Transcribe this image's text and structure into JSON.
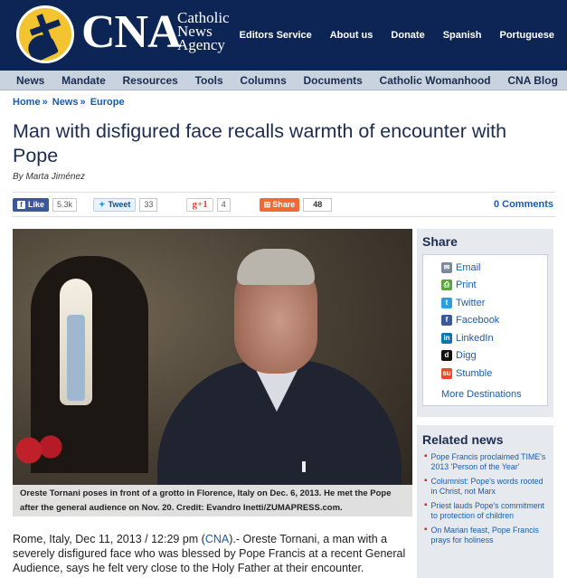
{
  "header": {
    "logo_text": "CNA",
    "logo_sub": [
      "Catholic",
      "News",
      "Agency"
    ],
    "top_links": [
      "Editors Service",
      "About us",
      "Donate",
      "Spanish",
      "Portuguese"
    ]
  },
  "main_nav": [
    "News",
    "Mandate",
    "Resources",
    "Tools",
    "Columns",
    "Documents",
    "Catholic Womanhood",
    "CNA Blog"
  ],
  "breadcrumb": [
    "Home",
    "News",
    "Europe"
  ],
  "article": {
    "title": "Man with disfigured face recalls warmth of encounter with Pope",
    "byline": "By Marta Jiménez",
    "caption": "Oreste Tornani poses in front of a grotto in Florence, Italy on Dec. 6, 2013. He met the Pope after the general audience on Nov. 20. Credit: Evandro Inetti/ZUMAPRESS.com.",
    "body_prefix": "Rome, Italy, Dec 11, 2013 / 12:29 pm (",
    "body_link": "CNA",
    "body_suffix": ").- Oreste Tornani, a man with a severely disfigured face who was blessed by Pope Francis at a recent General Audience, says he felt very close to the Holy Father at their encounter."
  },
  "social": {
    "like_label": "Like",
    "like_count": "5.3k",
    "tweet_label": "Tweet",
    "tweet_count": "33",
    "gplus_label": "+1",
    "gplus_count": "4",
    "share_label": "Share",
    "share_count": "48",
    "comments": "0 Comments"
  },
  "share_box": {
    "title": "Share",
    "items": [
      {
        "label": "Email",
        "icon": "email-icon",
        "color": "#7a8a9a"
      },
      {
        "label": "Print",
        "icon": "print-icon",
        "color": "#5aa33f"
      },
      {
        "label": "Twitter",
        "icon": "twitter-icon",
        "color": "#2a9ee0"
      },
      {
        "label": "Facebook",
        "icon": "facebook-icon",
        "color": "#3b5998"
      },
      {
        "label": "LinkedIn",
        "icon": "linkedin-icon",
        "color": "#0e76a8"
      },
      {
        "label": "Digg",
        "icon": "digg-icon",
        "color": "#111111"
      },
      {
        "label": "Stumble",
        "icon": "stumbleupon-icon",
        "color": "#eb4823"
      }
    ],
    "more": "More Destinations"
  },
  "related": {
    "title": "Related news",
    "items": [
      "Pope Francis proclaimed TIME's 2013 'Person of the Year'",
      "Columnist: Pope's words rooted in Christ, not Marx",
      "Priest lauds Pope's commitment to protection of children",
      "On Marian feast, Pope Francis prays for holiness"
    ]
  },
  "colors": {
    "header_bg": "#0d2555",
    "nav_bg": "#c9d3e0",
    "link": "#1a5ca8",
    "title": "#1d2d50"
  }
}
